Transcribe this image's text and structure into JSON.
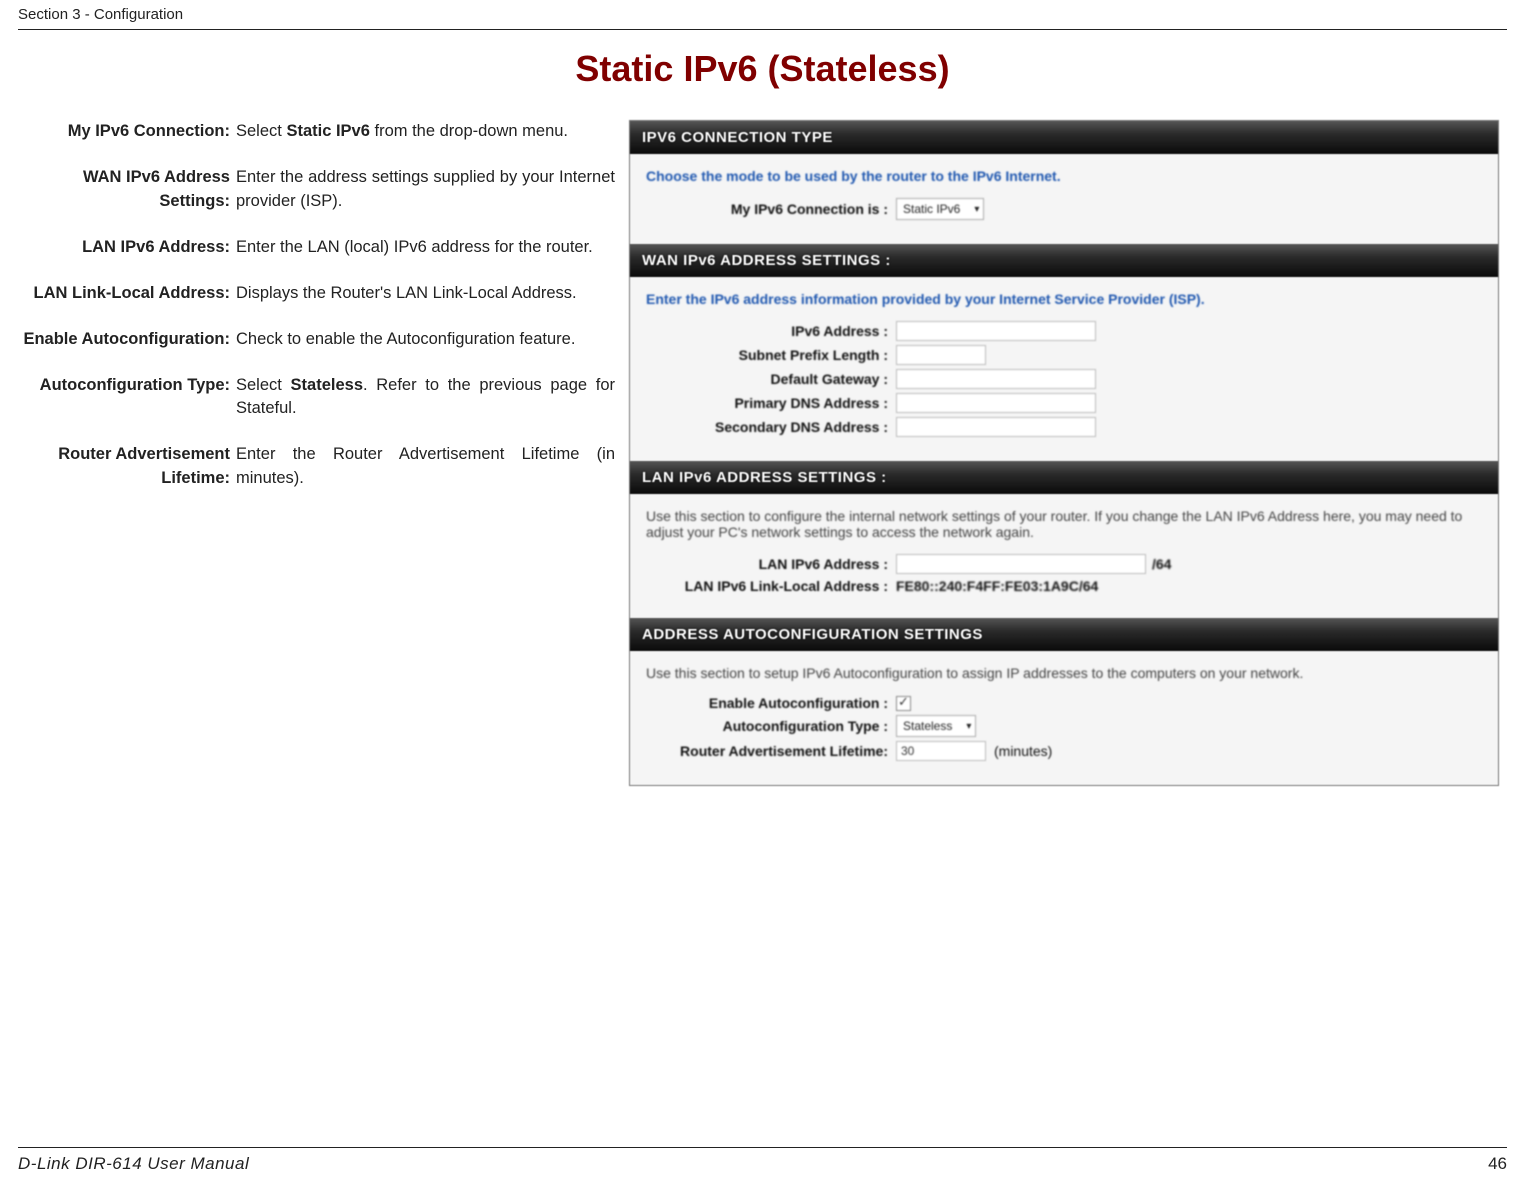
{
  "header": {
    "section": "Section 3 - Configuration"
  },
  "title": "Static IPv6 (Stateless)",
  "definitions": [
    {
      "label": "My IPv6 Connection:",
      "desc": "Select <strong>Static IPv6</strong> from the drop-down menu."
    },
    {
      "label": "WAN IPv6 Address Settings:",
      "desc": "Enter the address settings supplied by your Internet provider (ISP)."
    },
    {
      "label": "LAN IPv6 Address:",
      "desc": "Enter the LAN (local) IPv6 address for the router."
    },
    {
      "label": "LAN Link-Local Address:",
      "desc": "Displays the Router's LAN Link-Local Address."
    },
    {
      "label": "Enable Autoconfiguration:",
      "desc": "Check to enable the Autoconfiguration feature."
    },
    {
      "label": "Autoconfiguration Type:",
      "desc": "Select <strong>Stateless</strong>. Refer to the previous page for Stateful."
    },
    {
      "label": "Router Advertisement Lifetime:",
      "desc": "Enter the Router Advertisement Lifetime (in minutes)."
    }
  ],
  "panel": {
    "conn": {
      "head": "IPV6 CONNECTION TYPE",
      "instr": "Choose the mode to be used by the router to the IPv6 Internet.",
      "label": "My IPv6 Connection is :",
      "value": "Static IPv6"
    },
    "wan": {
      "head": "WAN IPv6 ADDRESS SETTINGS :",
      "instr": "Enter the IPv6 address information provided by your Internet Service Provider (ISP).",
      "rows": [
        "IPv6 Address :",
        "Subnet Prefix Length :",
        "Default Gateway :",
        "Primary DNS Address :",
        "Secondary DNS Address :"
      ]
    },
    "lan": {
      "head": "LAN IPv6 ADDRESS SETTINGS :",
      "instr": "Use this section to configure the internal network settings of your router. If you change the LAN IPv6 Address here, you may need to adjust your PC's network settings to access the network again.",
      "addr_label": "LAN IPv6 Address :",
      "addr_suffix": "/64",
      "ll_label": "LAN IPv6 Link-Local Address :",
      "ll_value": "FE80::240:F4FF:FE03:1A9C/64"
    },
    "auto": {
      "head": "ADDRESS AUTOCONFIGURATION SETTINGS",
      "instr": "Use this section to setup IPv6 Autoconfiguration to assign IP addresses to the computers on your network.",
      "enable_label": "Enable Autoconfiguration :",
      "type_label": "Autoconfiguration Type :",
      "type_value": "Stateless",
      "life_label": "Router Advertisement Lifetime:",
      "life_value": "30",
      "life_unit": "(minutes)"
    }
  },
  "footer": {
    "manual": "D-Link DIR-614 User Manual",
    "page": "46"
  }
}
